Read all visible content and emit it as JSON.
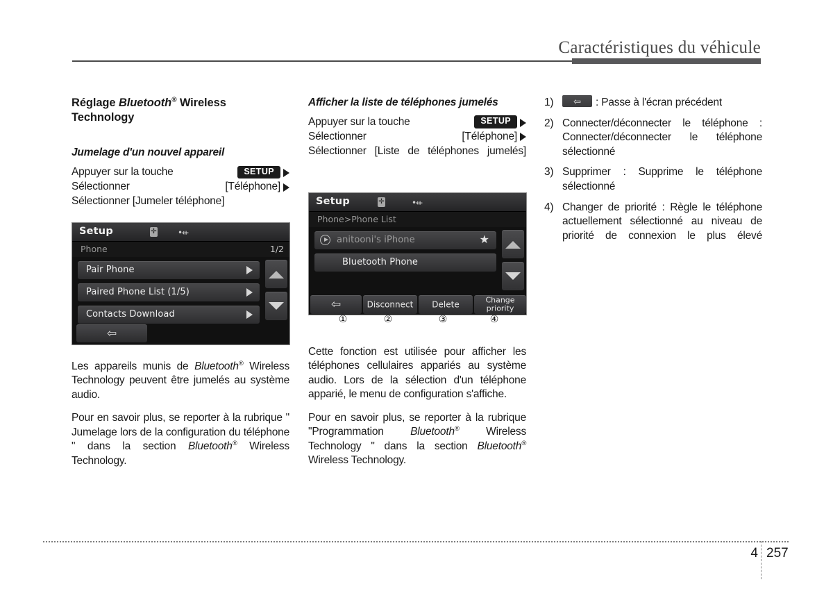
{
  "header": {
    "title": "Caractéristiques du véhicule"
  },
  "left_column": {
    "section_title_parts": {
      "pre": "Réglage ",
      "brand": "Bluetooth",
      "reg": "®",
      "post": " Wireless Technology"
    },
    "subsection_title": "Jumelage d'un nouvel appareil",
    "steps": [
      {
        "text": "Appuyer sur la touche",
        "key": "SETUP",
        "arrow": "▶"
      },
      {
        "text_a": "Sélectionner",
        "text_b": "[Téléphone]",
        "arrow": "▶"
      },
      {
        "text": "Sélectionner [Jumeler téléphone]",
        "arrow": ""
      }
    ],
    "screenshot": {
      "title": "Setup",
      "bt_icon": "bluetooth-icon",
      "usb_icon": "usb-icon",
      "breadcrumb": "Phone",
      "page_indicator": "1/2",
      "rows": [
        {
          "label": "Pair Phone",
          "arrow": "▶"
        },
        {
          "label": "Paired Phone List (1/5)",
          "arrow": "▶"
        },
        {
          "label": "Contacts Download",
          "arrow": "▶"
        }
      ],
      "scroll_up": "▲",
      "scroll_down": "▼",
      "back_glyph": "⇦"
    },
    "paragraphs": {
      "p1_a": "Les appareils munis de ",
      "p1_bt": "Bluetooth",
      "p1_reg": "®",
      "p1_b": " Wireless Technology peuvent être jumelés au système audio.",
      "p2_a": "Pour en savoir plus, se reporter à la rubrique \" Jumelage lors de la configuration du téléphone \" dans la section ",
      "p2_bt": "Bluetooth",
      "p2_reg": "®",
      "p2_b": " Wireless Technology."
    }
  },
  "middle_column": {
    "subsection_title": "Afficher la liste de téléphones jumelés",
    "steps": [
      {
        "text": "Appuyer sur la touche",
        "key": "SETUP",
        "arrow": "▶"
      },
      {
        "text_a": "Sélectionner",
        "text_b": "[Téléphone]",
        "arrow": "▶"
      },
      {
        "text": "Sélectionner [Liste de téléphones jumelés]",
        "arrow": ""
      }
    ],
    "screenshot": {
      "title": "Setup",
      "bt_icon": "bluetooth-icon",
      "usb_icon": "usb-icon",
      "breadcrumb": "Phone>Phone List",
      "rows": [
        {
          "label": "anitooni's iPhone",
          "star": "★",
          "play": "play-icon"
        },
        {
          "label": "Bluetooth Phone"
        }
      ],
      "scroll_up": "▲",
      "scroll_down": "▼",
      "footer_buttons": [
        {
          "label": "",
          "glyph": "⇦",
          "callout": "①"
        },
        {
          "label": "Disconnect",
          "callout": "②"
        },
        {
          "label": "Delete",
          "callout": "③"
        },
        {
          "label": "Change priority",
          "callout": "④"
        }
      ]
    },
    "paragraphs": {
      "p1": "Cette fonction est utilisée pour afficher les téléphones cellulaires appariés au système audio. Lors de la sélection d'un téléphone apparié, le menu de configuration s'affiche.",
      "p2_a": "Pour en savoir plus, se reporter à la rubrique \"",
      "p2_b": "Programmation ",
      "p2_bt1": "Bluetooth",
      "p2_reg1": "®",
      "p2_c": " Wireless Technology \" dans la section ",
      "p2_bt2": "Bluetooth",
      "p2_reg2": "®",
      "p2_d": " Wireless Technology."
    }
  },
  "right_column": {
    "items": [
      {
        "marker": "1)",
        "icon": "back-arrow-key",
        "icon_glyph": "⇦",
        "text": ": Passe à l'écran précédent"
      },
      {
        "marker": "2)",
        "text": "Connecter/déconnecter le téléphone : Connecter/déconnecter le téléphone sélectionné"
      },
      {
        "marker": "3)",
        "text": "Supprimer : Supprime le téléphone sélectionné"
      },
      {
        "marker": "4)",
        "text": "Changer de priorité : Règle le téléphone actuellement sélectionné au niveau de priorité de connexion le plus élevé"
      }
    ]
  },
  "footer": {
    "chapter": "4",
    "page": "257"
  }
}
